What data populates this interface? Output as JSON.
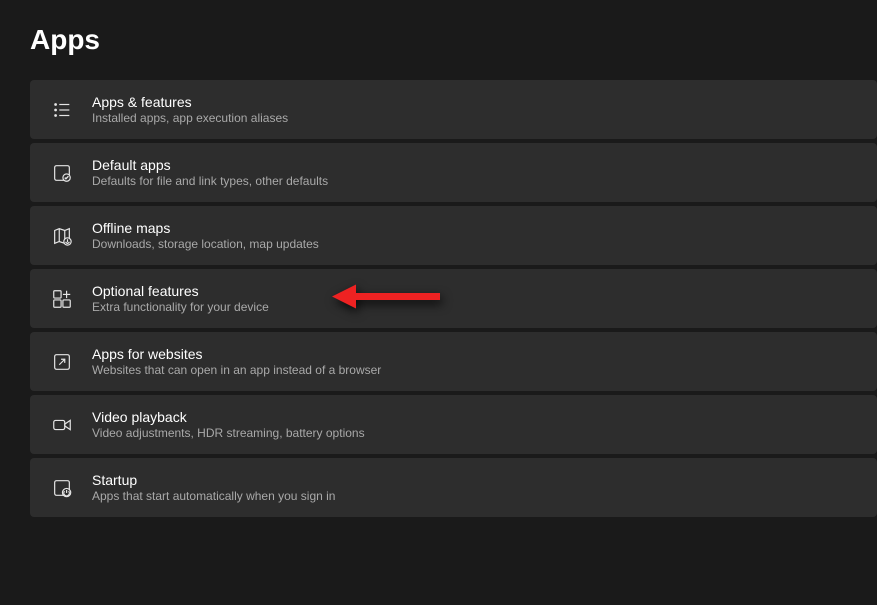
{
  "page": {
    "title": "Apps"
  },
  "items": [
    {
      "title": "Apps & features",
      "desc": "Installed apps, app execution aliases"
    },
    {
      "title": "Default apps",
      "desc": "Defaults for file and link types, other defaults"
    },
    {
      "title": "Offline maps",
      "desc": "Downloads, storage location, map updates"
    },
    {
      "title": "Optional features",
      "desc": "Extra functionality for your device"
    },
    {
      "title": "Apps for websites",
      "desc": "Websites that can open in an app instead of a browser"
    },
    {
      "title": "Video playback",
      "desc": "Video adjustments, HDR streaming, battery options"
    },
    {
      "title": "Startup",
      "desc": "Apps that start automatically when you sign in"
    }
  ]
}
